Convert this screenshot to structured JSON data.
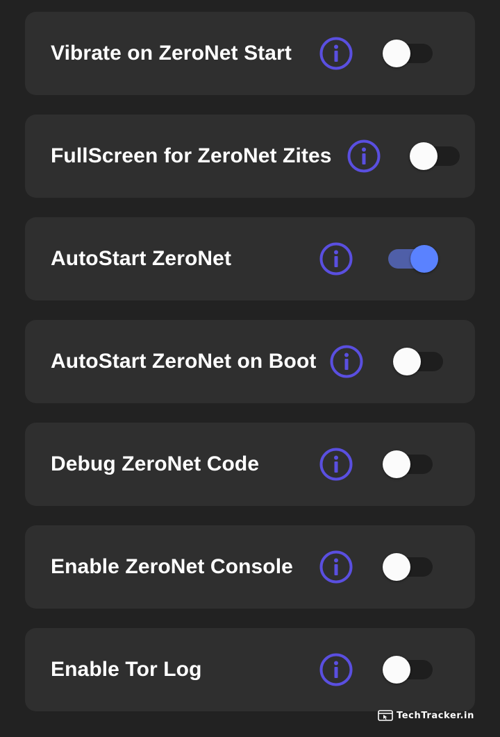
{
  "settings": [
    {
      "label": "Vibrate on ZeroNet Start",
      "enabled": false
    },
    {
      "label": "FullScreen for ZeroNet Zites",
      "enabled": false
    },
    {
      "label": "AutoStart ZeroNet",
      "enabled": true
    },
    {
      "label": "AutoStart ZeroNet on Boot",
      "enabled": false
    },
    {
      "label": "Debug ZeroNet Code",
      "enabled": false
    },
    {
      "label": "Enable ZeroNet Console",
      "enabled": false
    },
    {
      "label": "Enable Tor Log",
      "enabled": false
    }
  ],
  "icons": {
    "info": "info-icon",
    "watermark": "browser-icon"
  },
  "colors": {
    "background": "#222222",
    "card": "#2f2f2f",
    "info_icon": "#5a4fe0",
    "toggle_on_thumb": "#5a82ff",
    "toggle_on_track": "#4f5fa8",
    "toggle_off_thumb": "#fbfbfb",
    "toggle_off_track": "#1e1e1e"
  },
  "watermark": {
    "text": "TechTracker.in"
  }
}
